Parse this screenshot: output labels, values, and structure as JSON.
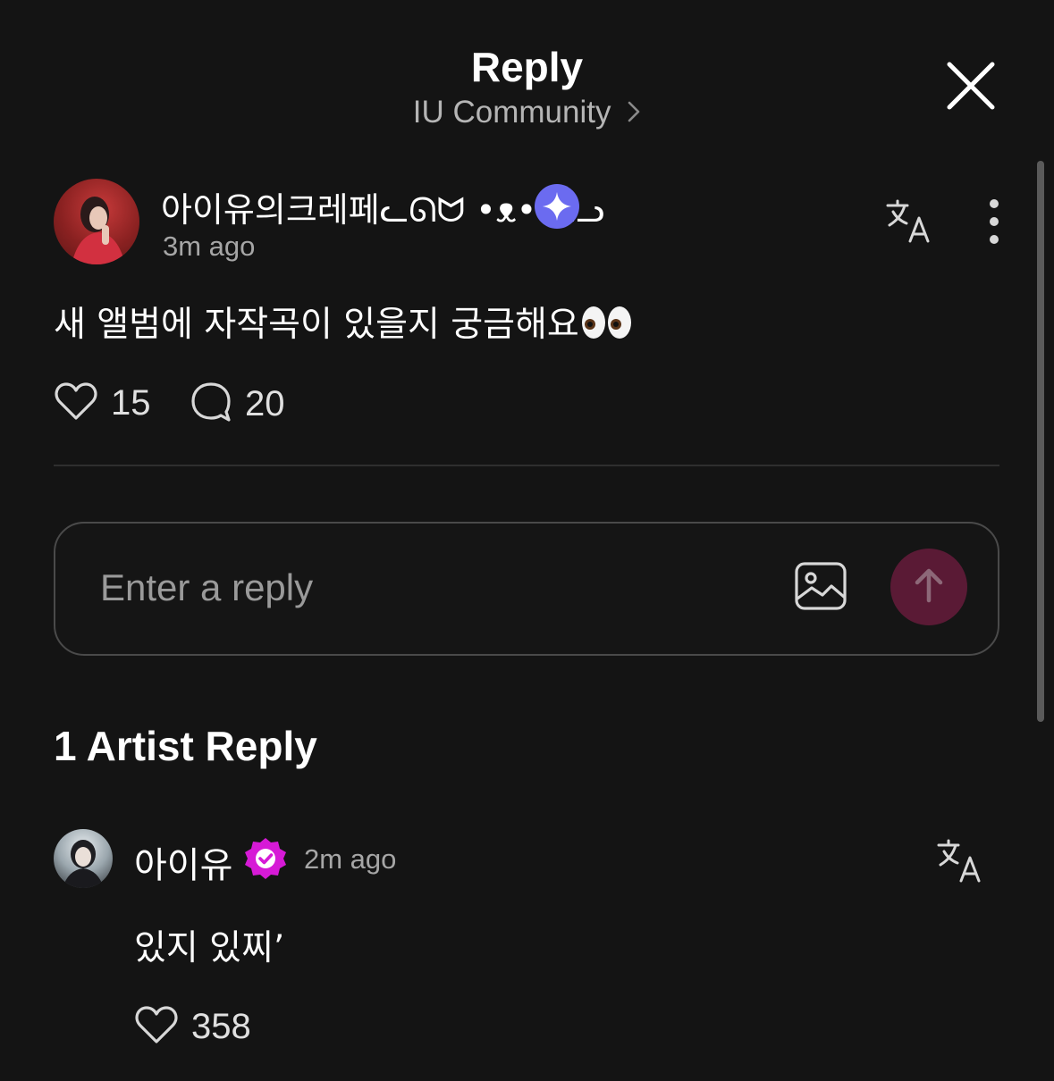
{
  "header": {
    "title": "Reply",
    "community": "IU Community"
  },
  "post": {
    "author": "아이유의크레페ᓚᘏᗢ •ᴥ• ᘏᓗ",
    "time": "3m ago",
    "body": "새 앨범에 자작곡이 있을지 궁금해요",
    "likes": "15",
    "comments": "20"
  },
  "reply_input": {
    "placeholder": "Enter a reply"
  },
  "artist_section": {
    "title": "1 Artist Reply"
  },
  "artist_reply": {
    "author": "아이유",
    "time": "2m ago",
    "body": "있지 있찌’",
    "likes": "358"
  },
  "colors": {
    "background": "#141414",
    "badge_purple": "#6b6bf0",
    "verified_pink": "#d61ad6",
    "send_button": "#5a1a35"
  },
  "icons": [
    "close-icon",
    "chevron-right-icon",
    "sparkle-icon",
    "translate-icon",
    "more-vertical-icon",
    "heart-icon",
    "comment-icon",
    "image-icon",
    "arrow-up-icon",
    "verified-icon",
    "eyes-emoji"
  ]
}
